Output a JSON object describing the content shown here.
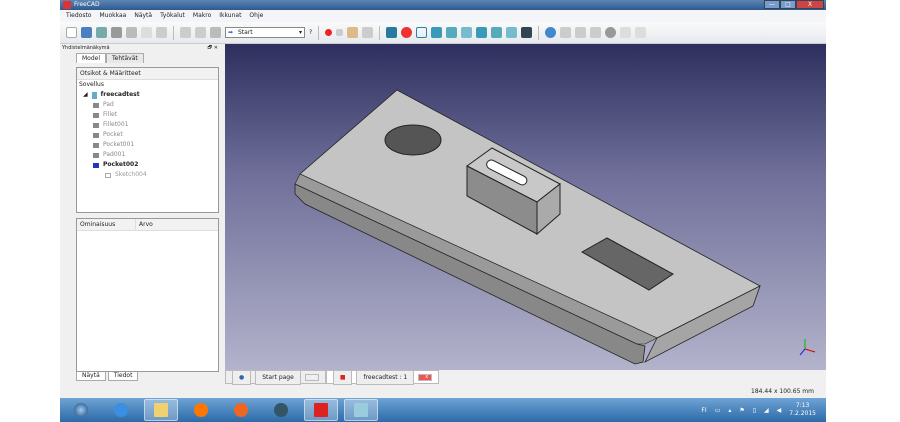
{
  "window": {
    "title": "FreeCAD",
    "min": "—",
    "max": "□",
    "close": "X"
  },
  "menu": [
    "Tiedosto",
    "Muokkaa",
    "Näytä",
    "Työkalut",
    "Makro",
    "Ikkunat",
    "Ohje"
  ],
  "toolbar": {
    "workbench": "Start",
    "whats_this": "?"
  },
  "combo_view": {
    "title": "Yhdistelmänäkymä",
    "float": "🗗",
    "close": "✕",
    "tabs": [
      "Model",
      "Tehtävät"
    ],
    "tree_header": "Otsikot & Määritteet",
    "root": "Sovellus",
    "document": "freecadtest",
    "items": [
      "Pad",
      "Fillet",
      "Fillet001",
      "Pocket",
      "Pocket001",
      "Pad001",
      "Pocket002",
      "Sketch004"
    ],
    "prop_headers": [
      "Ominaisuus",
      "Arvo"
    ],
    "bottom_tabs": [
      "Näytä",
      "Tiedot"
    ]
  },
  "doc_tabs": [
    {
      "label": "Start page"
    },
    {
      "label": "freecadtest : 1"
    }
  ],
  "status": {
    "dimensions": "184.44 x 100.65 mm"
  },
  "tray": {
    "lang": "FI",
    "time": "7:13",
    "date": "7.2.2015"
  },
  "colors": {
    "accent": "#2d5a8e"
  }
}
